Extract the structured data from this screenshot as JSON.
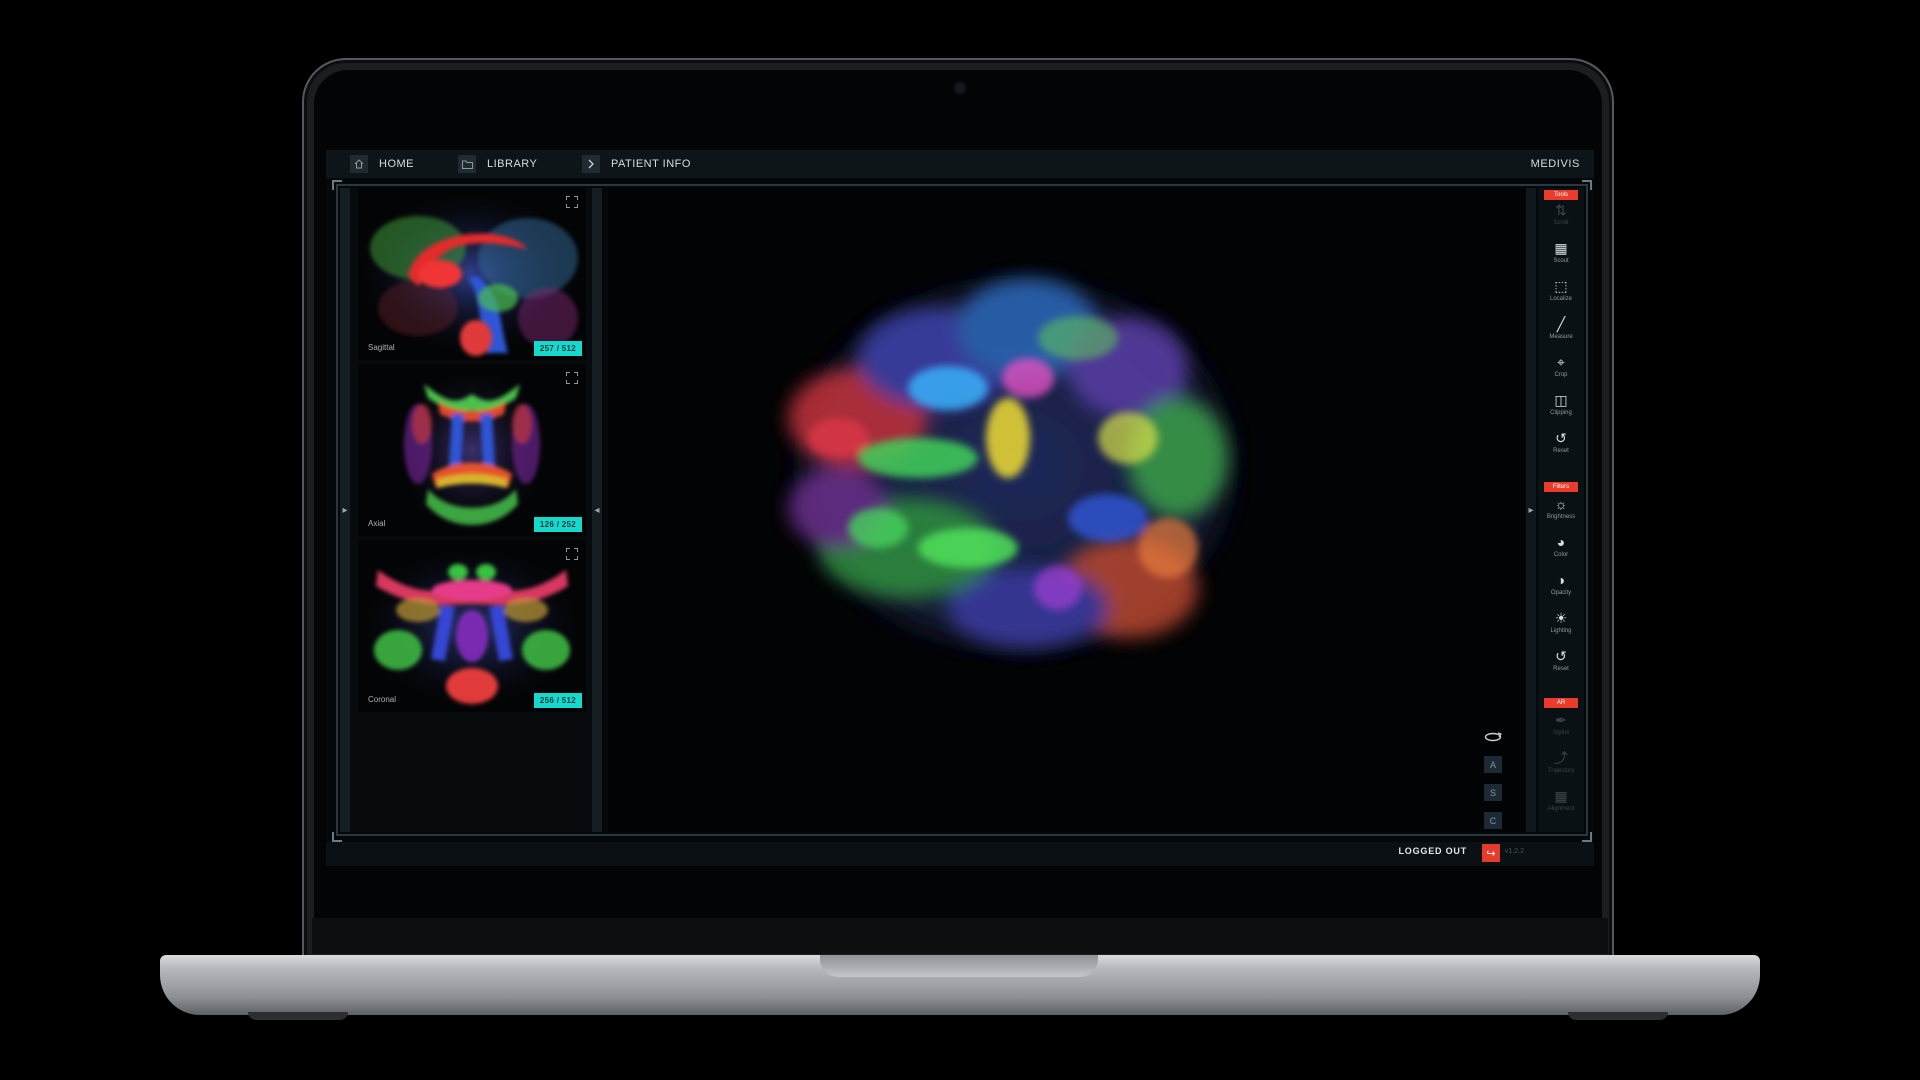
{
  "nav": {
    "breadcrumbs": [
      {
        "label": "HOME",
        "icon": "home-icon"
      },
      {
        "label": "LIBRARY",
        "icon": "folder-icon"
      },
      {
        "label": "PATIENT INFO",
        "icon": "chevron-right-icon"
      }
    ],
    "brand": "MEDIVIS"
  },
  "views": [
    {
      "label": "Sagittal",
      "slice": "257 / 512"
    },
    {
      "label": "Axial",
      "slice": "126 / 252"
    },
    {
      "label": "Coronal",
      "slice": "256 / 512"
    }
  ],
  "viewport": {
    "orientation_buttons": [
      "A",
      "S",
      "C"
    ],
    "rotate_icon": "rotate-icon"
  },
  "toolbar": {
    "sections": [
      {
        "title": "Tools",
        "items": [
          {
            "label": "Scroll",
            "icon": "scroll-icon",
            "dim": true
          },
          {
            "label": "Scout",
            "icon": "scout-grid-icon",
            "dim": false
          },
          {
            "label": "Localize",
            "icon": "localize-icon",
            "dim": false
          },
          {
            "label": "Measure",
            "icon": "ruler-icon",
            "dim": false
          },
          {
            "label": "Crop",
            "icon": "crop-icon",
            "dim": false
          },
          {
            "label": "Clipping",
            "icon": "clipping-icon",
            "dim": false
          },
          {
            "label": "Reset",
            "icon": "reset-icon",
            "dim": false
          }
        ]
      },
      {
        "title": "Filters",
        "items": [
          {
            "label": "Brightness",
            "icon": "sun-icon",
            "dim": false
          },
          {
            "label": "Color",
            "icon": "palette-icon",
            "dim": false
          },
          {
            "label": "Opacity",
            "icon": "opacity-icon",
            "dim": false
          },
          {
            "label": "Lighting",
            "icon": "bulb-icon",
            "dim": false
          },
          {
            "label": "Reset",
            "icon": "reset-icon",
            "dim": false
          }
        ]
      },
      {
        "title": "AR",
        "items": [
          {
            "label": "Stylus",
            "icon": "stylus-icon",
            "dim": true
          },
          {
            "label": "Trajectory",
            "icon": "trajectory-icon",
            "dim": true
          },
          {
            "label": "Alignment",
            "icon": "alignment-icon",
            "dim": true
          }
        ]
      }
    ]
  },
  "footer": {
    "status": "LOGGED OUT",
    "version": "v1.2.2"
  },
  "colors": {
    "accent_teal": "#16d9cc",
    "accent_red": "#ea3b2b",
    "panel": "#0d1519"
  }
}
